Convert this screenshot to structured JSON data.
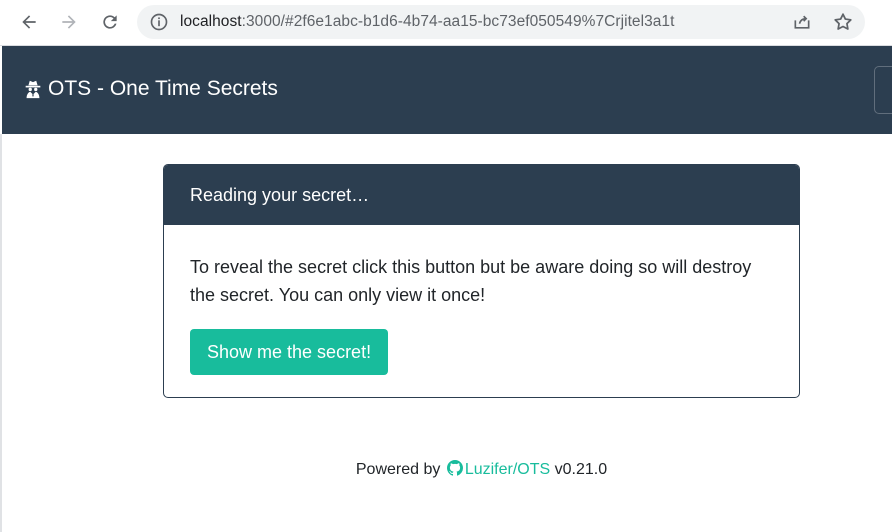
{
  "browser": {
    "url_host": "localhost",
    "url_rest": ":3000/#2f6e1abc-b1d6-4b74-aa15-bc73ef050549%7Crjitel3a1t"
  },
  "navbar": {
    "brand_label": "OTS - One Time Secrets"
  },
  "card": {
    "header": "Reading your secret…",
    "body_text": "To reveal the secret click this button but be aware doing so will destroy the secret. You can only view it once!",
    "button_label": "Show me the secret!"
  },
  "footer": {
    "prefix": "Powered by",
    "link_text": "Luzifer/OTS",
    "version": "v0.21.0"
  },
  "colors": {
    "navbar_bg": "#2c3e50",
    "accent": "#18bc9c"
  },
  "icons": {
    "back": "arrow-left-icon",
    "forward": "arrow-right-icon",
    "reload": "reload-icon",
    "info": "info-icon",
    "share": "share-icon",
    "bookmark": "star-icon",
    "brand": "user-secret-icon",
    "github": "github-icon"
  }
}
